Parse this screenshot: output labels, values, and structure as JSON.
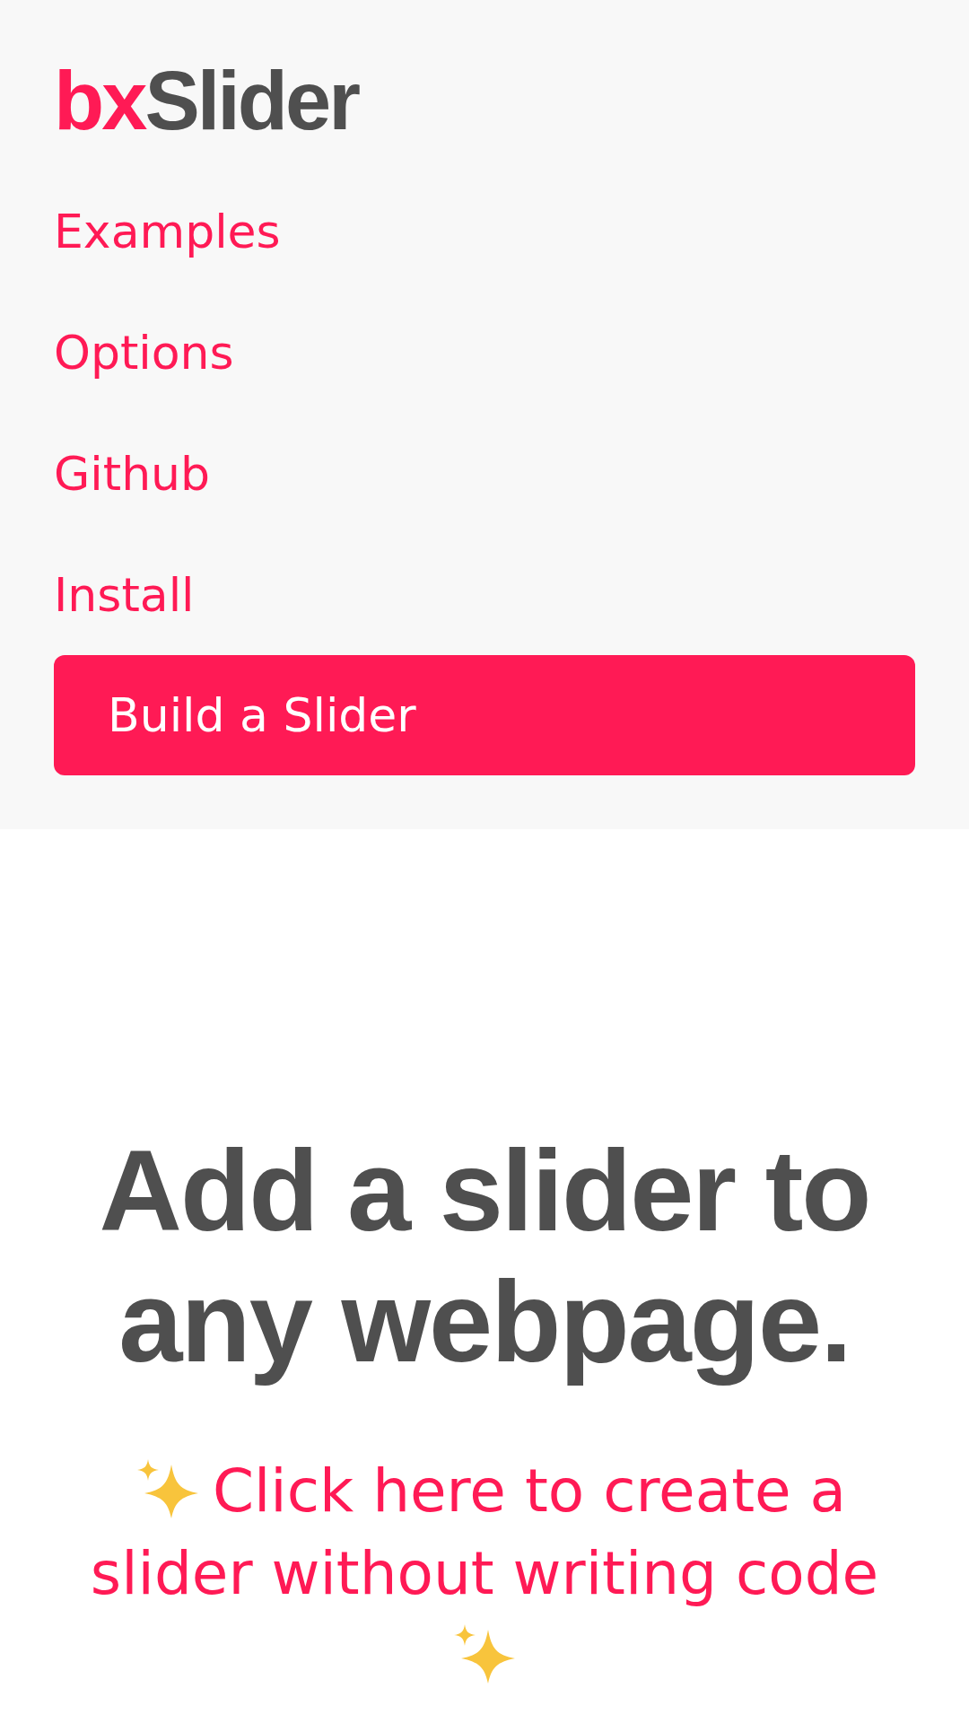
{
  "logo": {
    "accent": "bx",
    "rest": "Slider"
  },
  "nav": [
    {
      "label": "Examples",
      "kind": "link"
    },
    {
      "label": "Options",
      "kind": "link"
    },
    {
      "label": "Github",
      "kind": "link"
    },
    {
      "label": "Install",
      "kind": "link"
    },
    {
      "label": "Build a Slider",
      "kind": "button"
    }
  ],
  "hero": {
    "title": "Add a slider to any webpage.",
    "link": "Click here to create a slider without writing code"
  }
}
